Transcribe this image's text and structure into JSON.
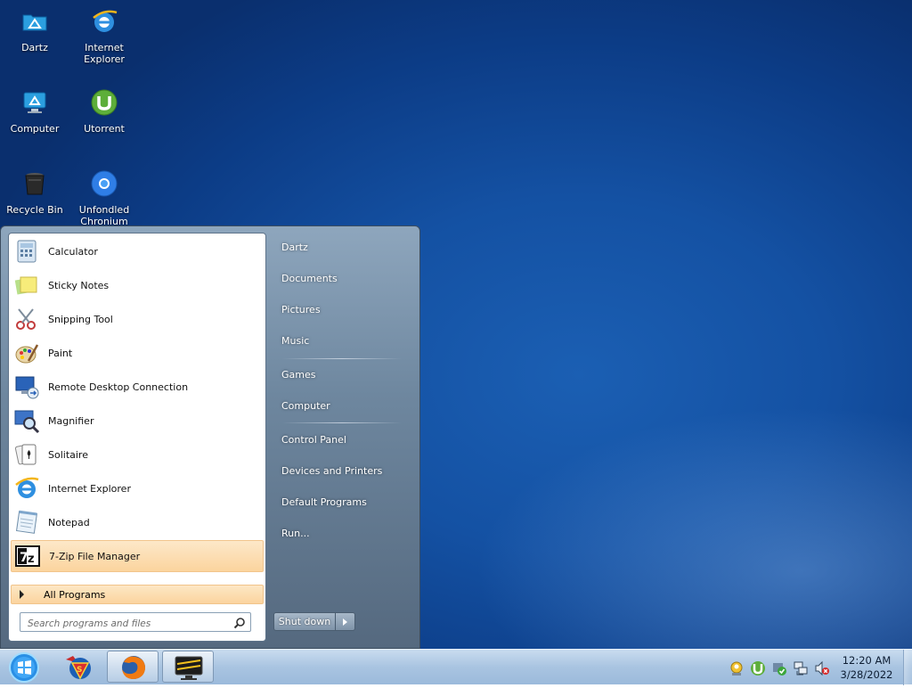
{
  "desktop": {
    "icons": [
      {
        "label": "Dartz"
      },
      {
        "label": "Internet Explorer"
      },
      {
        "label": "Computer"
      },
      {
        "label": "Utorrent"
      },
      {
        "label": "Recycle Bin"
      },
      {
        "label": "Unfondled Chronium"
      }
    ]
  },
  "start_menu": {
    "programs": [
      {
        "label": "Calculator"
      },
      {
        "label": "Sticky Notes"
      },
      {
        "label": "Snipping Tool"
      },
      {
        "label": "Paint"
      },
      {
        "label": "Remote Desktop Connection"
      },
      {
        "label": "Magnifier"
      },
      {
        "label": "Solitaire"
      },
      {
        "label": "Internet Explorer"
      },
      {
        "label": "Notepad"
      },
      {
        "label": "7-Zip File Manager"
      }
    ],
    "all_programs_label": "All Programs",
    "search_placeholder": "Search programs and files",
    "right_items": [
      {
        "label": "Dartz"
      },
      {
        "label": "Documents"
      },
      {
        "label": "Pictures"
      },
      {
        "label": "Music"
      },
      {
        "label": "Games"
      },
      {
        "label": "Computer"
      },
      {
        "label": "Control Panel"
      },
      {
        "label": "Devices and Printers"
      },
      {
        "label": "Default Programs"
      },
      {
        "label": "Run..."
      }
    ],
    "shutdown_label": "Shut down"
  },
  "taskbar": {
    "time": "12:20 AM",
    "date": "3/28/2022",
    "colors": {
      "accent": "#1451a3",
      "taskbar": "#a9c4e1"
    }
  }
}
